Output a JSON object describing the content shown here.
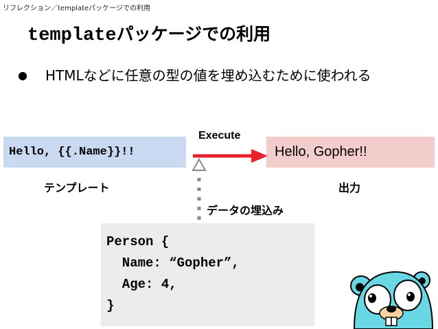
{
  "breadcrumb": "リフレクション／templateパッケージでの利用",
  "title": {
    "code": "template",
    "rest": "パッケージでの利用"
  },
  "bullet": {
    "marker": "●",
    "text": "HTMLなどに任意の型の値を埋め込むために使われる"
  },
  "diagram": {
    "template_code": "Hello, {{.Name}}!!",
    "template_label": "テンプレート",
    "execute_label": "Execute",
    "output_text": "Hello, Gopher!!",
    "output_label": "出力",
    "embed_label": "データの埋込み",
    "person_code": [
      "Person {",
      "  Name: “Gopher”,",
      "  Age: 4,",
      "}"
    ]
  },
  "colors": {
    "template_box": "#c9d9f1",
    "output_box": "#f3cccc",
    "person_box": "#ececec",
    "arrow": "#e8202a",
    "dotted_arrow": "#888888",
    "gopher": "#6ad7e5"
  },
  "icons": {
    "mascot": "gopher-mascot-icon"
  }
}
